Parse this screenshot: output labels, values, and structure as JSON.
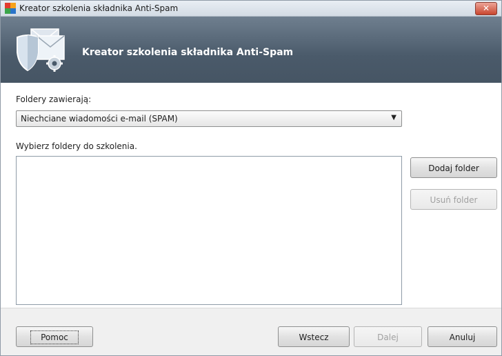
{
  "window": {
    "title": "Kreator szkolenia składnika Anti-Spam",
    "close_label": "✕"
  },
  "banner": {
    "title": "Kreator szkolenia składnika Anti-Spam",
    "icon": "shield-envelope-gear-icon"
  },
  "form": {
    "folders_contain_label": "Foldery zawierają:",
    "folder_type_select": {
      "selected": "Niechciane wiadomości e-mail (SPAM)"
    },
    "select_folders_label": "Wybierz foldery do szkolenia.",
    "folders_list": []
  },
  "side_buttons": {
    "add_folder": "Dodaj folder",
    "remove_folder": "Usuń folder"
  },
  "footer": {
    "help": "Pomoc",
    "back": "Wstecz",
    "next": "Dalej",
    "cancel": "Anuluj"
  }
}
